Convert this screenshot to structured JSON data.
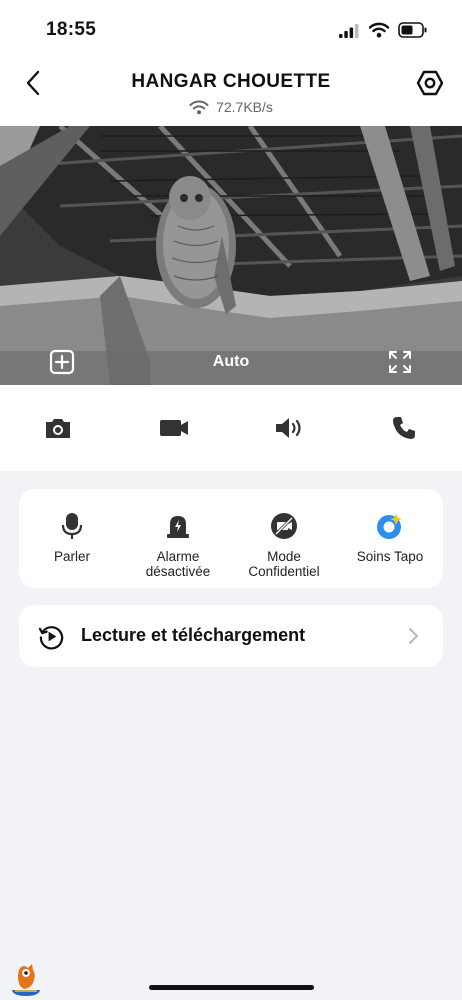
{
  "status_bar": {
    "time": "18:55"
  },
  "header": {
    "title": "HANGAR CHOUETTE",
    "speed": "72.7KB/s"
  },
  "video": {
    "quality_label": "Auto"
  },
  "toolbar": {
    "icons": [
      "camera-icon",
      "video-record-icon",
      "speaker-icon",
      "phone-icon"
    ]
  },
  "features": [
    {
      "label": "Parler",
      "icon": "microphone-icon"
    },
    {
      "label": "Alarme\ndésactivée",
      "icon": "siren-icon"
    },
    {
      "label": "Mode\nConfidentiel",
      "icon": "privacy-camera-off-icon"
    },
    {
      "label": "Soins Tapo",
      "icon": "tapo-care-icon"
    }
  ],
  "playback": {
    "label": "Lecture et téléchargement"
  },
  "colors": {
    "background": "#f1f3f6",
    "card": "#ffffff",
    "tapo_blue": "#2b8ef0",
    "tapo_yellow": "#f5c518"
  }
}
